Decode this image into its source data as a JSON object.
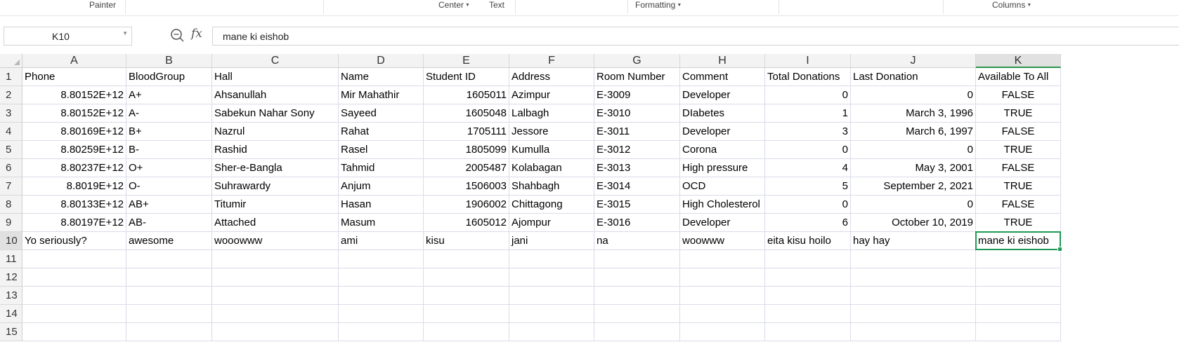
{
  "ribbon": {
    "painter": "Painter",
    "center": "Center",
    "text": "Text",
    "formatting": "Formatting",
    "columns": "Columns"
  },
  "namebox": {
    "value": "K10"
  },
  "formula_bar": {
    "fx": "fx",
    "value": "mane ki eishob"
  },
  "sheet": {
    "columns": [
      "A",
      "B",
      "C",
      "D",
      "E",
      "F",
      "G",
      "H",
      "I",
      "J",
      "K"
    ],
    "selected_cell": "K10",
    "row_numbers": [
      "1",
      "2",
      "3",
      "4",
      "5",
      "6",
      "7",
      "8",
      "9",
      "10",
      "11",
      "12",
      "13",
      "14",
      "15"
    ],
    "rows": [
      [
        "Phone",
        "BloodGroup",
        "Hall",
        "Name",
        "Student ID",
        "Address",
        "Room Number",
        "Comment",
        "Total Donations",
        "Last Donation",
        "Available To All"
      ],
      [
        "8.80152E+12",
        "A+",
        "Ahsanullah",
        "Mir Mahathir",
        "1605011",
        "Azimpur",
        "E-3009",
        "Developer",
        "0",
        "0",
        "FALSE"
      ],
      [
        "8.80152E+12",
        "A-",
        "Sabekun Nahar Sony",
        "Sayeed",
        "1605048",
        "Lalbagh",
        "E-3010",
        "DIabetes",
        "1",
        "March 3, 1996",
        "TRUE"
      ],
      [
        "8.80169E+12",
        "B+",
        "Nazrul",
        "Rahat",
        "1705111",
        "Jessore",
        "E-3011",
        "Developer",
        "3",
        "March 6, 1997",
        "FALSE"
      ],
      [
        "8.80259E+12",
        "B-",
        "Rashid",
        "Rasel",
        "1805099",
        "Kumulla",
        "E-3012",
        "Corona",
        "0",
        "0",
        "TRUE"
      ],
      [
        "8.80237E+12",
        "O+",
        "Sher-e-Bangla",
        "Tahmid",
        "2005487",
        "Kolabagan",
        "E-3013",
        "High pressure",
        "4",
        "May 3, 2001",
        "FALSE"
      ],
      [
        "8.8019E+12",
        "O-",
        "Suhrawardy",
        "Anjum",
        "1506003",
        "Shahbagh",
        "E-3014",
        "OCD",
        "5",
        "September 2, 2021",
        "TRUE"
      ],
      [
        "8.80133E+12",
        "AB+",
        "Titumir",
        "Hasan",
        "1906002",
        "Chittagong",
        "E-3015",
        "High Cholesterol",
        "0",
        "0",
        "FALSE"
      ],
      [
        "8.80197E+12",
        "AB-",
        "Attached",
        "Masum",
        "1605012",
        "Ajompur",
        "E-3016",
        "Developer",
        "6",
        "October 10, 2019",
        "TRUE"
      ],
      [
        "Yo seriously?",
        "awesome",
        "wooowww",
        "ami",
        "kisu",
        "jani",
        "na",
        "woowww",
        "eita kisu hoilo",
        "hay hay",
        "mane ki eishob"
      ],
      [
        "",
        "",
        "",
        "",
        "",
        "",
        "",
        "",
        "",
        "",
        ""
      ],
      [
        "",
        "",
        "",
        "",
        "",
        "",
        "",
        "",
        "",
        "",
        ""
      ],
      [
        "",
        "",
        "",
        "",
        "",
        "",
        "",
        "",
        "",
        "",
        ""
      ],
      [
        "",
        "",
        "",
        "",
        "",
        "",
        "",
        "",
        "",
        "",
        ""
      ],
      [
        "",
        "",
        "",
        "",
        "",
        "",
        "",
        "",
        "",
        "",
        ""
      ]
    ]
  },
  "colors": {
    "selection": "#1f9a55",
    "header_bg": "#f3f3f3",
    "gridline": "#dadce8"
  }
}
